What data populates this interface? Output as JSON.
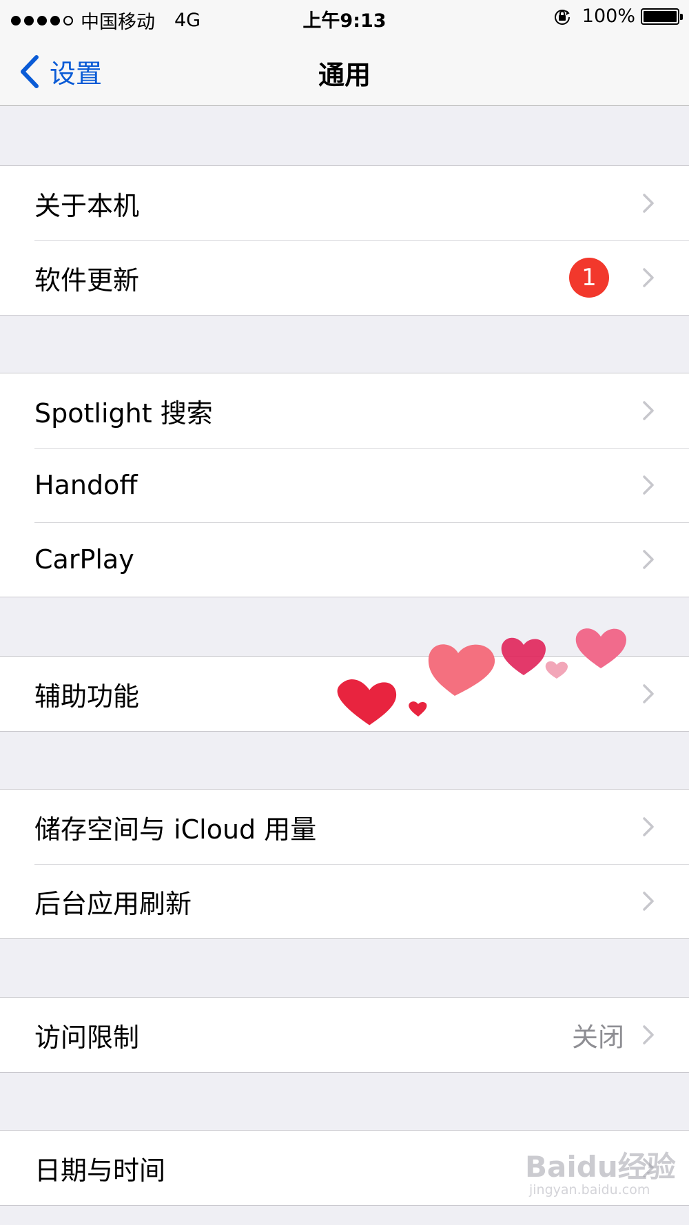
{
  "status_bar": {
    "carrier": "中国移动",
    "network": "4G",
    "time": "上午9:13",
    "battery": "100%",
    "signal_bars_filled": 4,
    "signal_bars_total": 5,
    "battery_level": 1.0,
    "lock_icon": "orientation-lock-icon"
  },
  "nav": {
    "back_label": "设置",
    "title": "通用",
    "back_icon": "chevron-left-icon"
  },
  "groups": [
    {
      "rows": [
        {
          "label": "关于本机"
        },
        {
          "label": "软件更新",
          "badge": "1"
        }
      ]
    },
    {
      "rows": [
        {
          "label": "Spotlight 搜索"
        },
        {
          "label": "Handoff"
        },
        {
          "label": "CarPlay"
        }
      ]
    },
    {
      "rows": [
        {
          "label": "辅助功能"
        }
      ]
    },
    {
      "rows": [
        {
          "label": "储存空间与 iCloud 用量"
        },
        {
          "label": "后台应用刷新"
        }
      ]
    },
    {
      "rows": [
        {
          "label": "访问限制",
          "detail": "关闭"
        }
      ]
    },
    {
      "rows": [
        {
          "label": "日期与时间"
        }
      ]
    }
  ],
  "watermark": {
    "brand": "Baidu经验",
    "url": "jingyan.baidu.com"
  },
  "colors": {
    "accent": "#0a5bd6",
    "badge": "#f2382c",
    "background": "#efeff4",
    "detail": "#8e8e93",
    "chevron": "#c7c7cc"
  }
}
